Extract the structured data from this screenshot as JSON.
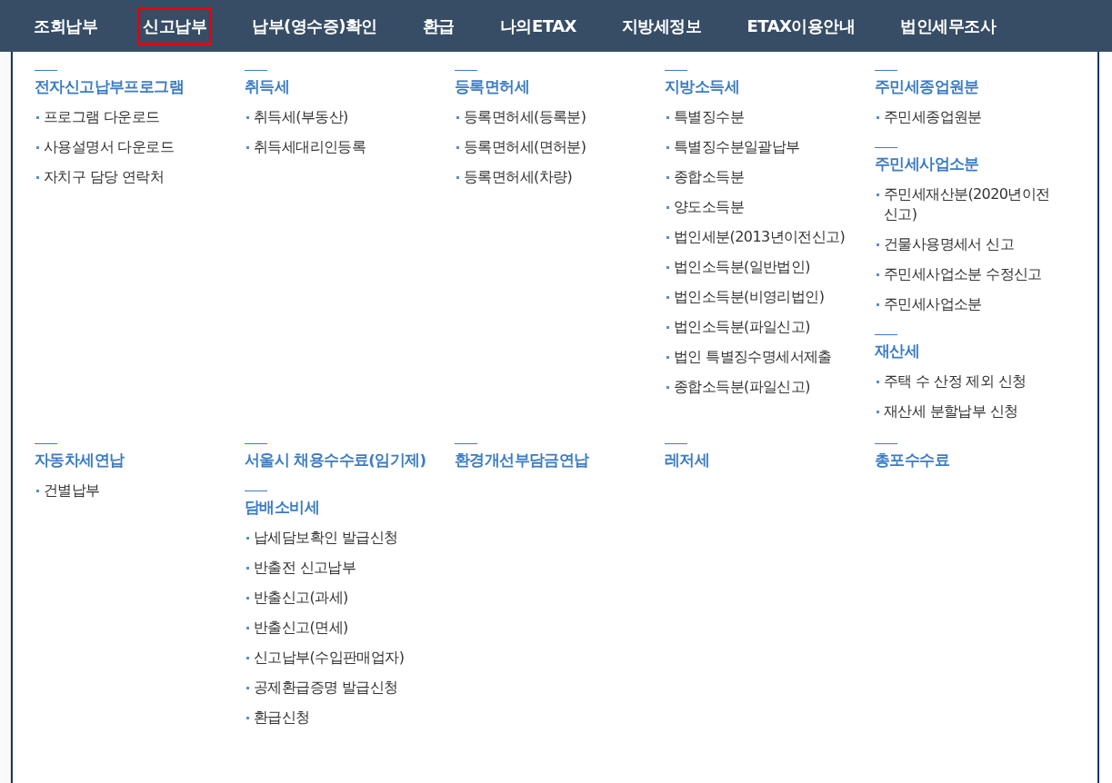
{
  "nav": [
    {
      "label": "조회납부",
      "selected": false
    },
    {
      "label": "신고납부",
      "selected": true
    },
    {
      "label": "납부(영수증)확인",
      "selected": false
    },
    {
      "label": "환급",
      "selected": false
    },
    {
      "label": "나의ETAX",
      "selected": false
    },
    {
      "label": "지방세정보",
      "selected": false
    },
    {
      "label": "ETAX이용안내",
      "selected": false
    },
    {
      "label": "법인세무조사",
      "selected": false
    }
  ],
  "menu_rows": [
    {
      "columns": [
        {
          "sections": [
            {
              "title": "전자신고납부프로그램",
              "items": [
                "프로그램 다운로드",
                "사용설명서 다운로드",
                "자치구 담당 연락처"
              ]
            }
          ]
        },
        {
          "sections": [
            {
              "title": "취득세",
              "items": [
                "취득세(부동산)",
                "취득세대리인등록"
              ]
            }
          ]
        },
        {
          "sections": [
            {
              "title": "등록면허세",
              "items": [
                "등록면허세(등록분)",
                "등록면허세(면허분)",
                "등록면허세(차량)"
              ]
            }
          ]
        },
        {
          "sections": [
            {
              "title": "지방소득세",
              "items": [
                "특별징수분",
                "특별징수분일괄납부",
                "종합소득분",
                "양도소득분",
                "법인세분(2013년이전신고)",
                "법인소득분(일반법인)",
                "법인소득분(비영리법인)",
                "법인소득분(파일신고)",
                "법인 특별징수명세서제출",
                "종합소득분(파일신고)"
              ]
            }
          ]
        },
        {
          "sections": [
            {
              "title": "주민세종업원분",
              "items": [
                "주민세종업원분"
              ]
            },
            {
              "title": "주민세사업소분",
              "items": [
                "주민세재산분(2020년이전 신고)",
                "건물사용명세서 신고",
                "주민세사업소분 수정신고",
                "주민세사업소분"
              ]
            },
            {
              "title": "재산세",
              "items": [
                "주택 수 산정 제외 신청",
                "재산세 분할납부 신청"
              ]
            }
          ]
        }
      ]
    },
    {
      "columns": [
        {
          "sections": [
            {
              "title": "자동차세연납",
              "items": [
                "건별납부"
              ]
            }
          ]
        },
        {
          "sections": [
            {
              "title": "서울시 채용수수료(임기제)"
            },
            {
              "title": "담배소비세",
              "items": [
                "납세담보확인 발급신청",
                "반출전 신고납부",
                "반출신고(과세)",
                "반출신고(면세)",
                "신고납부(수입판매업자)",
                "공제환급증명 발급신청",
                "환급신청"
              ]
            }
          ]
        },
        {
          "sections": [
            {
              "title": "환경개선부담금연납"
            }
          ]
        },
        {
          "sections": [
            {
              "title": "레저세"
            }
          ]
        },
        {
          "sections": [
            {
              "title": "총포수수료"
            }
          ]
        }
      ]
    }
  ]
}
